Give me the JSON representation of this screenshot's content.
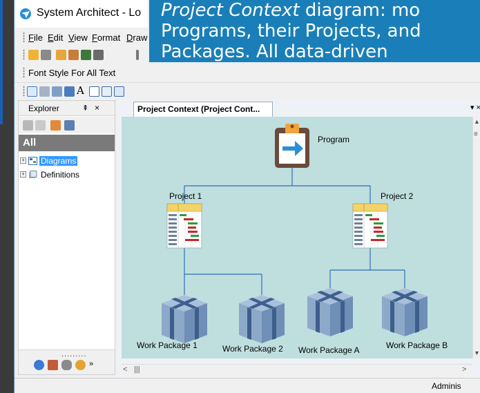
{
  "window": {
    "title": "System Architect - Lo"
  },
  "menubar": {
    "items": [
      "File",
      "Edit",
      "View",
      "Format",
      "Draw"
    ]
  },
  "format_toolbar": {
    "label": "Font Style For All Text"
  },
  "explorer": {
    "title": "Explorer",
    "pin_glyph": "⇞",
    "close_glyph": "×",
    "filter_label": "All",
    "tree": [
      {
        "label": "Diagrams",
        "selected": true,
        "icon": "diagram-icon"
      },
      {
        "label": "Definitions",
        "selected": false,
        "icon": "definitions-icon"
      }
    ],
    "footer_dots": "........."
  },
  "document": {
    "tab_title": "Project Context (Project Cont...",
    "tab_controls": "▾ ×"
  },
  "diagram": {
    "program": {
      "label": "Program"
    },
    "projects": [
      {
        "label": "Project 1"
      },
      {
        "label": "Project 2"
      }
    ],
    "work_packages": [
      {
        "label": "Work Package 1"
      },
      {
        "label": "Work Package 2"
      },
      {
        "label": "Work Package A"
      },
      {
        "label": "Work Package B"
      }
    ],
    "colors": {
      "canvas_bg": "#bfdede",
      "connector": "#2f6fb6",
      "clipboard_frame": "#6b4a3a",
      "clipboard_clip": "#f2a33a",
      "arrow": "#2a8fd6",
      "gantt_header": "#f3d36b",
      "cube_body": "#8da9c9",
      "cube_dark": "#5c7ea6"
    }
  },
  "statusbar": {
    "user_text": "Adminis"
  },
  "callout": {
    "line1_italic": "Project Context",
    "line1_rest": " diagram: mo",
    "line2": "Programs, their Projects, and",
    "line3": "Packages. All data-driven"
  }
}
